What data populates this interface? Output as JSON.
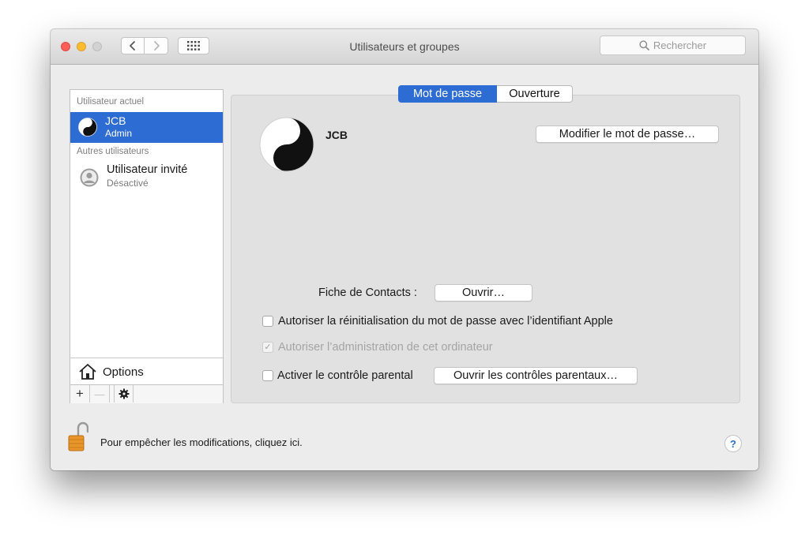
{
  "window": {
    "title": "Utilisateurs et groupes"
  },
  "toolbar": {
    "search_placeholder": "Rechercher",
    "back_icon": "chevron-left-icon",
    "forward_icon": "chevron-right-icon",
    "grid_icon": "grid-icon"
  },
  "sidebar": {
    "current_section": "Utilisateur actuel",
    "current_user": {
      "name": "JCB",
      "role": "Admin"
    },
    "others_section": "Autres utilisateurs",
    "others": [
      {
        "name": "Utilisateur invité",
        "status": "Désactivé"
      }
    ],
    "options_label": "Options",
    "add_label": "+",
    "remove_label": "—"
  },
  "tabs": [
    {
      "label": "Mot de passe",
      "active": true
    },
    {
      "label": "Ouverture",
      "active": false
    }
  ],
  "main": {
    "user_name": "JCB",
    "change_password_button": "Modifier le mot de passe…",
    "contacts_label": "Fiche de Contacts :",
    "contacts_button": "Ouvrir…",
    "checkboxes": [
      {
        "label": "Autoriser la réinitialisation du mot de passe avec l’identifiant Apple",
        "checked": false,
        "enabled": true
      },
      {
        "label": "Autoriser l’administration de cet ordinateur",
        "checked": true,
        "enabled": false
      },
      {
        "label": "Activer le contrôle parental",
        "checked": false,
        "enabled": true
      }
    ],
    "parental_button": "Ouvrir les contrôles parentaux…"
  },
  "footer": {
    "lock_text": "Pour empêcher les modifications, cliquez ici.",
    "help_label": "?"
  },
  "colors": {
    "accent": "#2d6cd3",
    "close": "#fc5f57",
    "minimize": "#fdbc2e",
    "zoom_inactive": "#d2d2d2"
  }
}
